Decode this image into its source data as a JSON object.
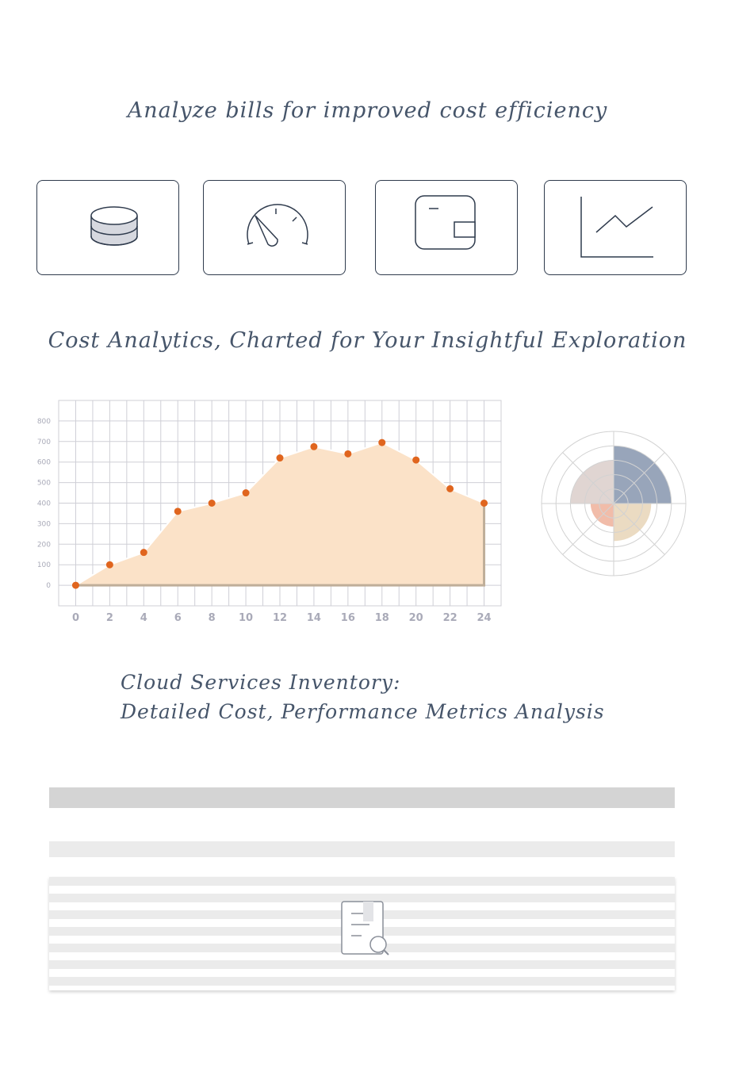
{
  "headings": {
    "title": "Analyze bills for improved cost efficiency",
    "charts": "Cost Analytics, Charted for Your Insightful Exploration",
    "inventory_line1": "Cloud Services Inventory:",
    "inventory_line2": "Detailed Cost, Performance Metrics Analysis"
  },
  "cards": [
    {
      "icon": "database-icon"
    },
    {
      "icon": "gauge-icon"
    },
    {
      "icon": "wallet-icon"
    },
    {
      "icon": "line-chart-icon"
    }
  ],
  "colors": {
    "area_fill": "#fbe2c8",
    "area_stroke": "#ffffff",
    "point": "#e0651e",
    "baseline": "#bfae99",
    "grid": "#cfcfd6",
    "tick": "#a9aab8",
    "polar_q1": "#8d9bb2",
    "polar_q2": "#e9d7bb",
    "polar_q3": "#f0b5a0",
    "polar_q4": "#ddd0cd",
    "table_header": "#d4d4d4",
    "table_row": "#ebebeb"
  },
  "chart_data": [
    {
      "type": "area",
      "x": [
        0,
        2,
        4,
        6,
        8,
        10,
        12,
        14,
        16,
        18,
        20,
        22,
        24
      ],
      "y": [
        0,
        100,
        160,
        360,
        400,
        450,
        620,
        675,
        640,
        695,
        610,
        470,
        400
      ],
      "x_ticks": [
        "0",
        "2",
        "4",
        "6",
        "8",
        "10",
        "12",
        "14",
        "16",
        "18",
        "20",
        "22",
        "24"
      ],
      "y_ticks": [
        "0",
        "100",
        "200",
        "300",
        "400",
        "500",
        "600",
        "700",
        "800"
      ],
      "xlim": [
        -1,
        25
      ],
      "ylim": [
        -100,
        900
      ],
      "grid": true
    },
    {
      "type": "polar-area",
      "values": [
        4,
        2.6,
        1.6,
        3
      ],
      "rmax": 5,
      "rings": 5,
      "spokes": 8,
      "grid": true
    }
  ],
  "table": {
    "empty_icon": "document-search-icon"
  }
}
